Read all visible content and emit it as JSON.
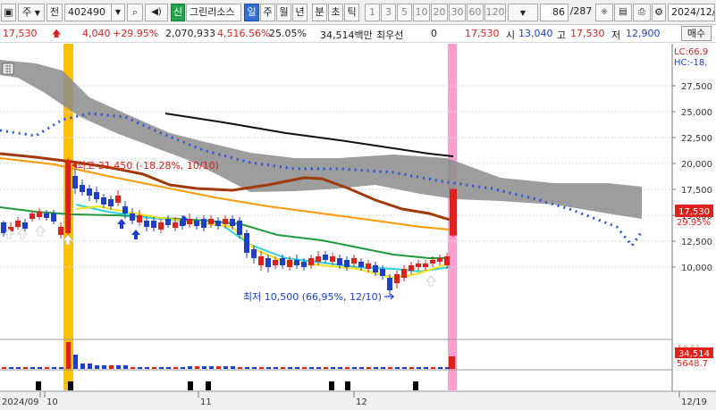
{
  "toolbar": {
    "menu_btn": "▣",
    "market": "주",
    "period_short": "전",
    "code": "402490",
    "dropdown": "▼",
    "search": "🔍",
    "speaker": "◀)",
    "tool_btn": "▾",
    "new_badge": "신",
    "stock_name": "그린리소스",
    "tab_day": "일",
    "tab_week": "주",
    "tab_month": "월",
    "tab_year": "년",
    "tab_min": "분",
    "tab_sec": "초",
    "tab_tick": "틱",
    "periods": [
      "1",
      "3",
      "5",
      "10",
      "20",
      "30",
      "60",
      "120"
    ],
    "count_display": "86",
    "count_total": "/287",
    "date": "2024/12/",
    "icons": [
      "grid-icon",
      "save-icon",
      "print-icon",
      "gear-icon"
    ]
  },
  "quote": {
    "price": "17,530",
    "change": "4,040",
    "change_pct": "+29.95%",
    "volume": "2,070,933",
    "volume_pct": "4,516.56%",
    "turnover": "25.05%",
    "amount": "34,514백만",
    "pref_label": "최우선",
    "pref_value": "0",
    "last": "17,530",
    "open_label": "시",
    "open": "13,040",
    "high_label": "고",
    "high": "17,530",
    "low_label": "저",
    "low": "12,900",
    "buy_button": "매수"
  },
  "chart_annotations": {
    "high_note": "최고 21,450 (-18.28%, 10/10)",
    "low_note": "최저 10,500 (66,95%, 12/10)",
    "lc": "LC:66,9",
    "hc": "HC:-18,",
    "price_tag": "17,530",
    "pct_tag": "29.95%",
    "vol_tag": "34,514",
    "vol_sub": "5648.7",
    "vol_tag2": "58,51"
  },
  "x_axis": {
    "labels": [
      "2024/09",
      "10",
      "11",
      "12",
      "12/19"
    ]
  },
  "chart_data": {
    "type": "candlestick",
    "y_ticks": [
      27500,
      25000,
      22500,
      20000,
      17500,
      15000,
      12500,
      10000
    ],
    "y_tick_labels": [
      "27,500",
      "25,000",
      "22,500",
      "20,000",
      "17,500",
      "15,000",
      "12,500",
      "10,000"
    ],
    "ylim": [
      7500,
      29500
    ],
    "last_price": 17530,
    "period_high": 21450,
    "period_low": 10500
  },
  "colors": {
    "up": "#e0211b",
    "down": "#1d3fd0",
    "cloud": "#8c8c8c",
    "highlight_yellow": "#ffc000",
    "highlight_pink": "#ff8fc8"
  }
}
